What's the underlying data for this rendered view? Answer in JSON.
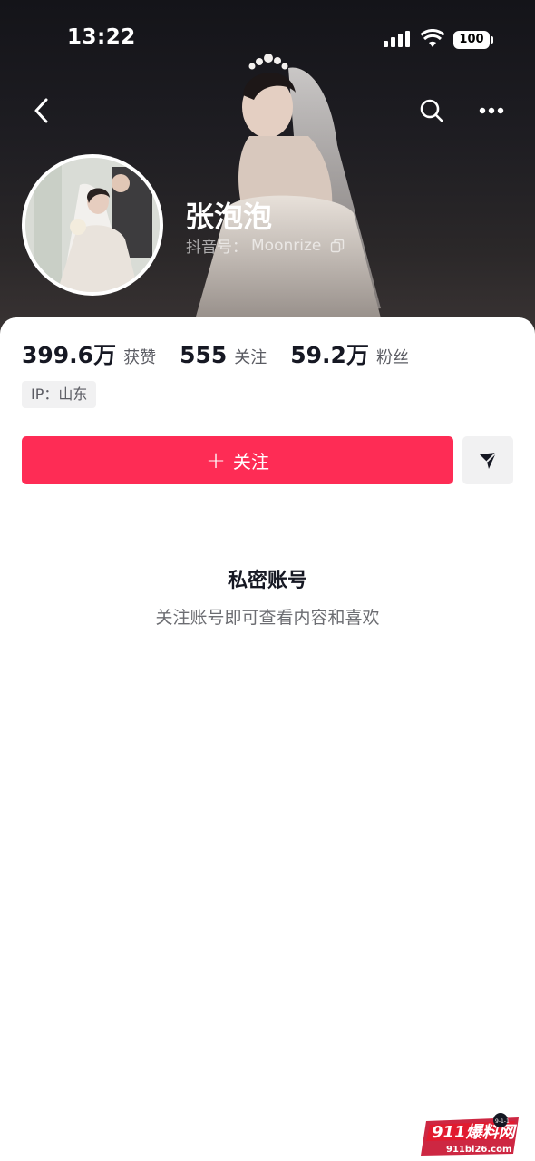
{
  "status_bar": {
    "time": "13:22",
    "battery": "100"
  },
  "profile": {
    "nickname": "张泡泡",
    "handle_label": "抖音号：",
    "handle": "Moonrize"
  },
  "stats": [
    {
      "value": "399.6万",
      "label": "获赞"
    },
    {
      "value": "555",
      "label": "关注"
    },
    {
      "value": "59.2万",
      "label": "粉丝"
    }
  ],
  "ip_tag": "IP：山东",
  "actions": {
    "follow_plus": "+",
    "follow_label": "关注"
  },
  "private": {
    "title": "私密账号",
    "description": "关注账号即可查看内容和喜欢"
  },
  "watermark": {
    "brand": "911爆料网",
    "url": "911bl26.com",
    "badge": "9-1-1"
  },
  "icons": {
    "back": "chevron-left-icon",
    "search": "search-icon",
    "more": "more-dots-icon",
    "copy": "copy-icon",
    "message": "send-arrow-icon"
  },
  "colors": {
    "accent": "#fe2c55",
    "header_bg": "#1e1d22",
    "text_primary": "#161823",
    "text_secondary": "#5b5c63"
  }
}
